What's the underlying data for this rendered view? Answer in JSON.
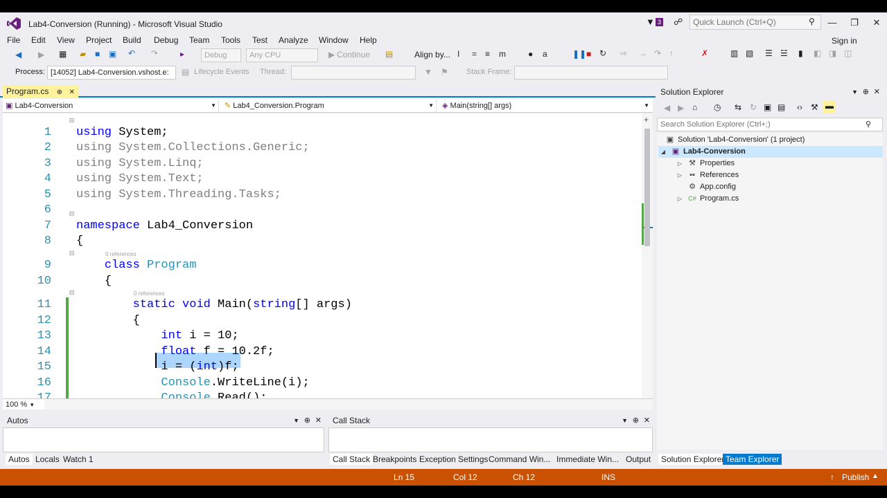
{
  "window": {
    "title": "Lab4-Conversion (Running) - Microsoft Visual Studio",
    "notification_count": "3",
    "quick_launch_placeholder": "Quick Launch (Ctrl+Q)",
    "sign_in": "Sign in"
  },
  "menu": [
    "File",
    "Edit",
    "View",
    "Project",
    "Build",
    "Debug",
    "Team",
    "Tools",
    "Test",
    "Analyze",
    "Window",
    "Help"
  ],
  "toolbar": {
    "config": "Debug",
    "platform": "Any CPU",
    "continue": "Continue",
    "align_by": "Align by...",
    "process_label": "Process:",
    "process_value": "[14052] Lab4-Conversion.vshost.e:",
    "lifecycle": "Lifecycle Events",
    "thread_label": "Thread:",
    "stack_frame_label": "Stack Frame:"
  },
  "editor": {
    "tab_label": "Program.cs",
    "nav_project": "Lab4-Conversion",
    "nav_class": "Lab4_Conversion.Program",
    "nav_member": "Main(string[] args)",
    "zoom": "100 %",
    "refs_label": "0 references",
    "line_numbers": [
      "1",
      "2",
      "3",
      "4",
      "5",
      "6",
      "7",
      "8",
      "9",
      "10",
      "11",
      "12",
      "13",
      "14",
      "15",
      "16",
      "17"
    ]
  },
  "panels": {
    "autos_title": "Autos",
    "autos_tabs": [
      "Autos",
      "Locals",
      "Watch 1"
    ],
    "callstack_title": "Call Stack",
    "callstack_tabs": [
      "Call Stack",
      "Breakpoints",
      "Exception Settings",
      "Command Win...",
      "Immediate Win...",
      "Output"
    ]
  },
  "solution_explorer": {
    "title": "Solution Explorer",
    "search_placeholder": "Search Solution Explorer (Ctrl+;)",
    "solution": "Solution 'Lab4-Conversion' (1 project)",
    "project": "Lab4-Conversion",
    "items": [
      "Properties",
      "References",
      "App.config",
      "Program.cs"
    ],
    "bottom_tabs": [
      "Solution Explorer",
      "Team Explorer"
    ]
  },
  "status": {
    "line": "Ln 15",
    "col": "Col 12",
    "ch": "Ch 12",
    "mode": "INS",
    "publish": "Publish"
  }
}
